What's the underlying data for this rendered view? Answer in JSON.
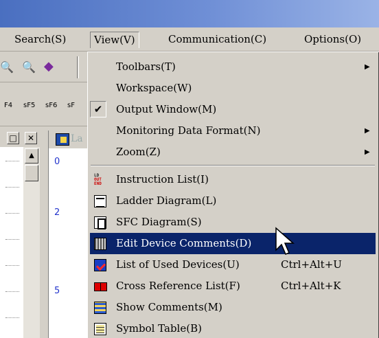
{
  "menubar": {
    "items": [
      "Search(S)",
      "View(V)",
      "Communication(C)",
      "Options(O)"
    ]
  },
  "ladder": {
    "title": "La",
    "steps": [
      "0",
      "2",
      "5"
    ]
  },
  "toolbar2": {
    "labels": [
      "F4",
      "sF5",
      "sF6",
      "sF"
    ]
  },
  "view_menu": {
    "items": [
      {
        "label": "Toolbars(T)",
        "submenu": true
      },
      {
        "label": "Workspace(W)"
      },
      {
        "label": "Output Window(M)",
        "checked": true,
        "check_glyph": "✔"
      },
      {
        "label": "Monitoring Data Format(N)",
        "submenu": true
      },
      {
        "label": "Zoom(Z)",
        "submenu": true
      },
      {
        "label": "Instruction List(I)",
        "icon": "instruction-list-icon",
        "icon_text": [
          "LD",
          "OUT",
          "END"
        ]
      },
      {
        "label": "Ladder Diagram(L)",
        "icon": "ladder-diagram-icon"
      },
      {
        "label": "SFC Diagram(S)",
        "icon": "sfc-diagram-icon"
      },
      {
        "label": "Edit Device Comments(D)",
        "icon": "edit-device-comments-icon",
        "highlighted": true
      },
      {
        "label": "List of Used Devices(U)",
        "icon": "used-devices-icon",
        "accelerator": "Ctrl+Alt+U"
      },
      {
        "label": "Cross Reference List(F)",
        "icon": "cross-reference-icon",
        "accelerator": "Ctrl+Alt+K"
      },
      {
        "label": "Show Comments(M)",
        "icon": "show-comments-icon"
      },
      {
        "label": "Symbol Table(B)",
        "icon": "symbol-table-icon"
      }
    ]
  },
  "window_buttons": {
    "restore": "□",
    "close": "✕"
  },
  "colors": {
    "highlight": "#0a246a",
    "menu_bg": "#d4d0c8",
    "title_start": "#4a6fc0",
    "step_number": "#2233cc"
  }
}
